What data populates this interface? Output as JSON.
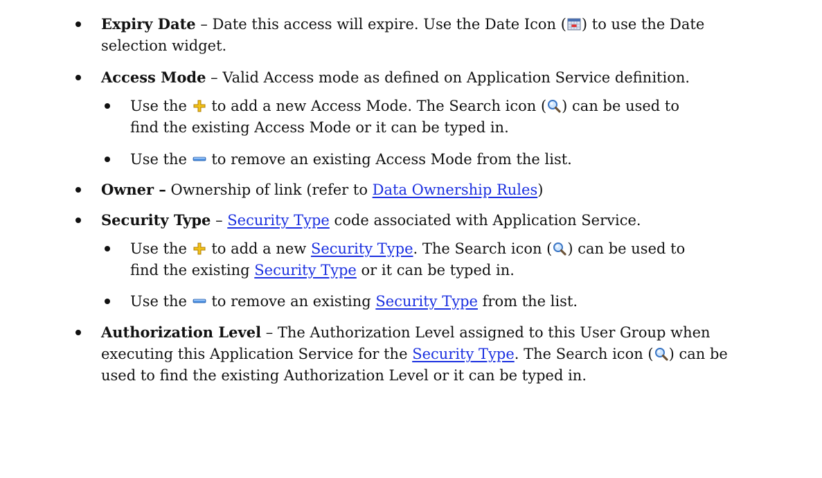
{
  "items": {
    "expiry": {
      "term": "Expiry Date",
      "l1_a": " – Date this access will expire. Use the Date Icon (",
      "l1_b": ") to use the Date",
      "l2": "selection widget."
    },
    "access_mode": {
      "term": "Access Mode",
      "text": " – Valid Access mode as defined on Application Service definition.",
      "sub1": {
        "l1_a": "Use the ",
        "l1_b": " to add a new Access Mode. The Search icon (",
        "l1_c": ") can be used to",
        "l2": "find the existing Access Mode or it can be typed in."
      },
      "sub2": {
        "a": "Use the ",
        "b": " to remove an existing Access Mode from the list."
      }
    },
    "owner": {
      "term": "Owner –",
      "a": " Ownership of link (refer to ",
      "link": "Data Ownership Rules",
      "b": ")"
    },
    "security_type": {
      "term": "Security Type",
      "a": " – ",
      "link": "Security Type",
      "b": " code associated with Application Service.",
      "sub1": {
        "l1_a": "Use the ",
        "l1_b": " to add a new ",
        "l1_link": "Security Type",
        "l1_c": ". The Search icon (",
        "l1_d": ") can be used to",
        "l2_a": "find the existing ",
        "l2_link": "Security Type",
        "l2_b": " or it can be typed in."
      },
      "sub2": {
        "a": "Use the ",
        "b": " to remove an existing ",
        "link": "Security Type",
        "c": " from the list."
      }
    },
    "auth_level": {
      "term": "Authorization Level",
      "l1": " – The Authorization Level assigned to this User Group when",
      "l2_a": "executing this Application Service for the ",
      "l2_link": "Security Type",
      "l2_b": ". The Search icon (",
      "l2_c": ") can be",
      "l3": "used to find the existing Authorization Level or it can be typed in."
    }
  },
  "icons": {
    "date": "calendar-icon",
    "add": "plus-icon",
    "remove": "minus-icon",
    "search": "magnifier-icon"
  },
  "colors": {
    "link": "#1a2fe0",
    "text": "#111111"
  }
}
